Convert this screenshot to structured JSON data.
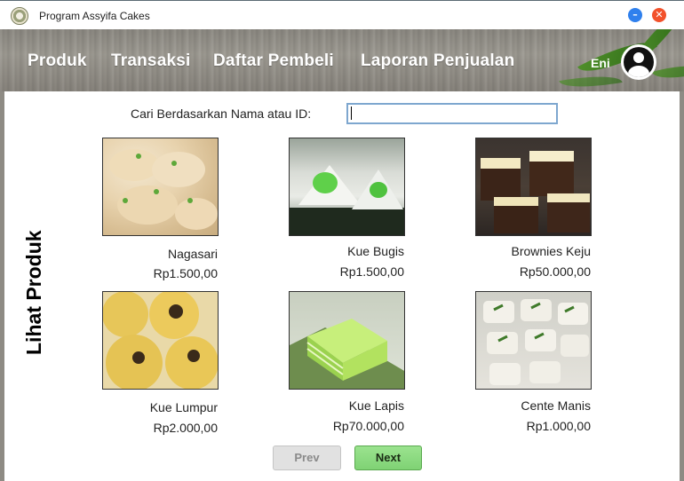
{
  "window": {
    "title": "Program Assyifa Cakes",
    "minimize_symbol": "–",
    "close_symbol": "✕"
  },
  "nav": {
    "items": [
      "Produk",
      "Transaksi",
      "Daftar Pembeli",
      "Laporan Penjualan"
    ],
    "user_name": "Eni"
  },
  "page": {
    "vertical_title": "Lihat Produk"
  },
  "search": {
    "label": "Cari Berdasarkan Nama atau ID:",
    "value": ""
  },
  "products": [
    {
      "name": "Nagasari",
      "price": "Rp1.500,00",
      "image": "dumplings-photo"
    },
    {
      "name": "Kue Bugis",
      "price": "Rp1.500,00",
      "image": "green-kue-photo"
    },
    {
      "name": "Brownies Keju",
      "price": "Rp50.000,00",
      "image": "brownies-cheese-photo"
    },
    {
      "name": "Kue Lumpur",
      "price": "Rp2.000,00",
      "image": "kue-lumpur-photo"
    },
    {
      "name": "Kue Lapis",
      "price": "Rp70.000,00",
      "image": "kue-lapis-photo"
    },
    {
      "name": "Cente Manis",
      "price": "Rp1.000,00",
      "image": "cente-manis-photo"
    }
  ],
  "pagination": {
    "prev_label": "Prev",
    "next_label": "Next"
  }
}
